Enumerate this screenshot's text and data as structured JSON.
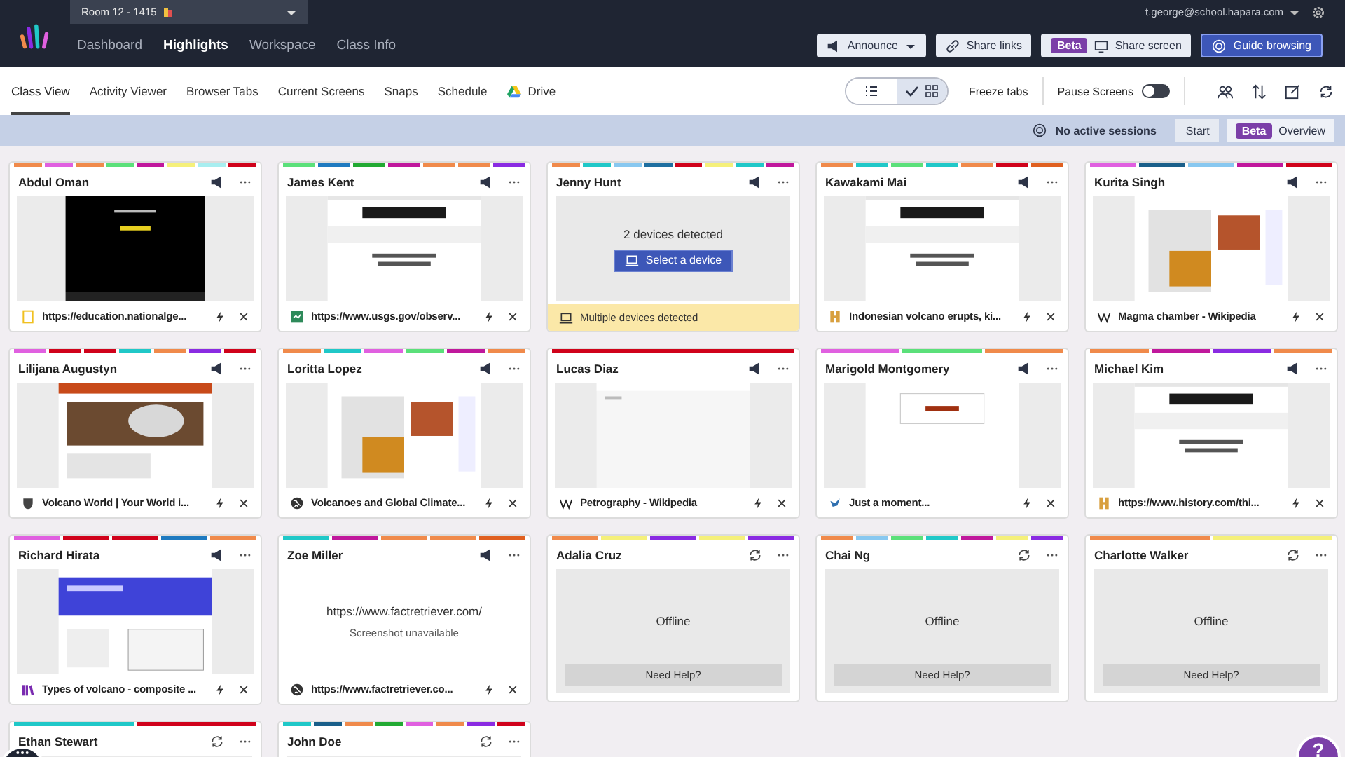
{
  "top": {
    "room": "Room 12 - 1415",
    "user": "t.george@school.hapara.com",
    "nav": [
      {
        "label": "Dashboard",
        "selected": false
      },
      {
        "label": "Highlights",
        "selected": true
      },
      {
        "label": "Workspace",
        "selected": false
      },
      {
        "label": "Class Info",
        "selected": false
      }
    ],
    "actions": [
      {
        "kind": "announce",
        "label": "Announce"
      },
      {
        "kind": "links",
        "label": "Share links"
      },
      {
        "kind": "share",
        "badge": "Beta",
        "label": "Share screen"
      },
      {
        "kind": "guide",
        "label": "Guide browsing"
      }
    ]
  },
  "tabs": [
    {
      "label": "Class View",
      "selected": true,
      "kind": "plain"
    },
    {
      "label": "Activity Viewer",
      "selected": false,
      "kind": "plain"
    },
    {
      "label": "Browser Tabs",
      "selected": false,
      "kind": "plain"
    },
    {
      "label": "Current Screens",
      "selected": false,
      "kind": "plain"
    },
    {
      "label": "Snaps",
      "selected": false,
      "kind": "plain"
    },
    {
      "label": "Schedule",
      "selected": false,
      "kind": "plain"
    },
    {
      "label": "Drive",
      "selected": false,
      "kind": "drive"
    }
  ],
  "toolbar": {
    "views": [
      {
        "kind": "list",
        "selected": false
      },
      {
        "kind": "grid",
        "selected": true
      }
    ],
    "freeze": "Freeze tabs",
    "pause": {
      "label": "Pause Screens",
      "on": false
    }
  },
  "sessions": {
    "status": "No active sessions",
    "start": "Start",
    "badge": "Beta",
    "overview": "Overview"
  },
  "cards": [
    {
      "name": "Abdul Oman",
      "kind": "screen",
      "title": "https://education.nationalge...",
      "strip": [
        {
          "color": "#f08a4b"
        },
        {
          "color": "#e060e0"
        },
        {
          "color": "#f08a4b"
        },
        {
          "color": "#5be07a"
        },
        {
          "color": "#c0189c"
        },
        {
          "color": "#f5f07a"
        },
        {
          "color": "#a8eef0"
        },
        {
          "color": "#d0021b"
        }
      ]
    },
    {
      "name": "James Kent",
      "kind": "screen",
      "title": "https://www.usgs.gov/observ...",
      "strip": [
        {
          "color": "#5be07a"
        },
        {
          "color": "#1f7ac0"
        },
        {
          "color": "#22aa33"
        },
        {
          "color": "#c0189c"
        },
        {
          "color": "#f08a4b"
        },
        {
          "color": "#f08a4b"
        },
        {
          "color": "#8a2be2"
        }
      ]
    },
    {
      "name": "Jenny Hunt",
      "kind": "devices",
      "message": "2 devices detected",
      "button": "Select a device",
      "title": "Multiple devices detected",
      "strip": [
        {
          "color": "#f08a4b"
        },
        {
          "color": "#20c8c8"
        },
        {
          "color": "#88c8f0"
        },
        {
          "color": "#1f6fa0"
        },
        {
          "color": "#d0021b"
        },
        {
          "color": "#f5f07a"
        },
        {
          "color": "#20c8c8"
        },
        {
          "color": "#c0189c"
        }
      ]
    },
    {
      "name": "Kawakami Mai",
      "kind": "screen",
      "title": "Indonesian volcano erupts, ki...",
      "strip": [
        {
          "color": "#f08a4b"
        },
        {
          "color": "#20c8c8"
        },
        {
          "color": "#5be07a"
        },
        {
          "color": "#20c8c8"
        },
        {
          "color": "#f08a4b"
        },
        {
          "color": "#d0021b"
        },
        {
          "color": "#e06020"
        }
      ]
    },
    {
      "name": "Kurita Singh",
      "kind": "screen",
      "title": "Magma chamber - Wikipedia",
      "strip": [
        {
          "color": "#e060e0"
        },
        {
          "color": "#1a5f8a"
        },
        {
          "color": "#88c8f0"
        },
        {
          "color": "#c0189c"
        },
        {
          "color": "#d0021b"
        }
      ]
    },
    {
      "name": "Lilijana Augustyn",
      "kind": "screen",
      "title": "Volcano World | Your World i...",
      "strip": [
        {
          "color": "#e060e0"
        },
        {
          "color": "#d0021b"
        },
        {
          "color": "#d0021b"
        },
        {
          "color": "#20c8c8"
        },
        {
          "color": "#f08a4b"
        },
        {
          "color": "#8a2be2"
        },
        {
          "color": "#d0021b"
        }
      ]
    },
    {
      "name": "Loritta Lopez",
      "kind": "screen",
      "title": "Volcanoes and Global Climate...",
      "strip": [
        {
          "color": "#f08a4b"
        },
        {
          "color": "#20c8c8"
        },
        {
          "color": "#e060e0"
        },
        {
          "color": "#5be07a"
        },
        {
          "color": "#c0189c"
        },
        {
          "color": "#f08a4b"
        }
      ]
    },
    {
      "name": "Lucas Diaz",
      "kind": "screen",
      "title": "Petrography - Wikipedia",
      "strip": [
        {
          "color": "#d0021b"
        }
      ]
    },
    {
      "name": "Marigold Montgomery",
      "kind": "screen",
      "title": "Just a moment...",
      "strip": [
        {
          "color": "#e060e0"
        },
        {
          "color": "#5be07a"
        },
        {
          "color": "#f08a4b"
        }
      ]
    },
    {
      "name": "Michael Kim",
      "kind": "screen",
      "title": "https://www.history.com/thi...",
      "strip": [
        {
          "color": "#f08a4b"
        },
        {
          "color": "#c0189c"
        },
        {
          "color": "#8a2be2"
        },
        {
          "color": "#f08a4b"
        }
      ]
    },
    {
      "name": "Richard Hirata",
      "kind": "screen",
      "title": "Types of volcano - composite ...",
      "strip": [
        {
          "color": "#e060e0"
        },
        {
          "color": "#d0021b"
        },
        {
          "color": "#d0021b"
        },
        {
          "color": "#1f7ac0"
        },
        {
          "color": "#f08a4b"
        }
      ]
    },
    {
      "name": "Zoe Miller",
      "kind": "unavailable",
      "message": "https://www.factretriever.com/",
      "note": "Screenshot unavailable",
      "title": "https://www.factretriever.co...",
      "strip": [
        {
          "color": "#20c8c8"
        },
        {
          "color": "#c0189c"
        },
        {
          "color": "#f08a4b"
        },
        {
          "color": "#f08a4b"
        },
        {
          "color": "#e06020"
        }
      ]
    },
    {
      "name": "Adalia Cruz",
      "kind": "offline",
      "message": "Offline",
      "button": "Need Help?",
      "strip": [
        {
          "color": "#f08a4b"
        },
        {
          "color": "#f5f07a"
        },
        {
          "color": "#8a2be2"
        },
        {
          "color": "#f5f07a"
        },
        {
          "color": "#8a2be2"
        }
      ]
    },
    {
      "name": "Chai Ng",
      "kind": "offline",
      "message": "Offline",
      "button": "Need Help?",
      "strip": [
        {
          "color": "#f08a4b"
        },
        {
          "color": "#88c8f0"
        },
        {
          "color": "#5be07a"
        },
        {
          "color": "#20c8c8"
        },
        {
          "color": "#c0189c"
        },
        {
          "color": "#f5f07a"
        },
        {
          "color": "#8a2be2"
        }
      ]
    },
    {
      "name": "Charlotte Walker",
      "kind": "offline",
      "message": "Offline",
      "button": "Need Help?",
      "strip": [
        {
          "color": "#f08a4b"
        },
        {
          "color": "#f5f07a"
        }
      ]
    },
    {
      "name": "Ethan Stewart",
      "kind": "offline",
      "strip": [
        {
          "color": "#20c8c8"
        },
        {
          "color": "#d0021b"
        }
      ]
    },
    {
      "name": "John Doe",
      "kind": "offline",
      "strip": [
        {
          "color": "#20c8c8"
        },
        {
          "color": "#1a5f8a"
        },
        {
          "color": "#f08a4b"
        },
        {
          "color": "#22aa33"
        },
        {
          "color": "#e060e0"
        },
        {
          "color": "#f08a4b"
        },
        {
          "color": "#8a2be2"
        },
        {
          "color": "#d0021b"
        }
      ]
    }
  ],
  "help": "?"
}
